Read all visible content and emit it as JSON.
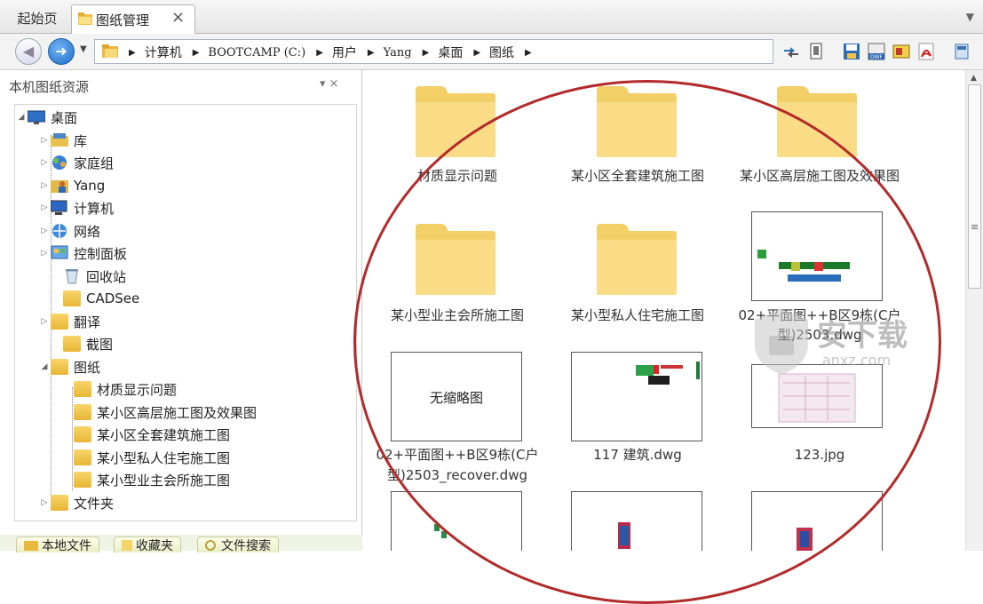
{
  "tabs": {
    "home": "起始页",
    "active": "图纸管理",
    "close": "×"
  },
  "address": {
    "crumbs": [
      "计算机",
      "BOOTCAMP (C:)",
      "用户",
      "Yang",
      "桌面",
      "图纸"
    ]
  },
  "panel": {
    "title": "本机图纸资源",
    "controls": "▾ ×"
  },
  "tree": {
    "root": "桌面",
    "items": [
      "库",
      "家庭组",
      "Yang",
      "计算机",
      "网络",
      "控制面板",
      "回收站",
      "CADSee",
      "翻译",
      "截图",
      "图纸",
      "文件夹"
    ],
    "children": [
      "材质显示问题",
      "某小区高层施工图及效果图",
      "某小区全套建筑施工图",
      "某小型私人住宅施工图",
      "某小型业主会所施工图"
    ]
  },
  "bottom_tabs": [
    "本地文件",
    "收藏夹",
    "文件搜索"
  ],
  "files": {
    "folder1": "材质显示问题",
    "folder2": "某小区全套建筑施工图",
    "folder3": "某小区高层施工图及效果图",
    "folder4": "某小型业主会所施工图",
    "folder5": "某小型私人住宅施工图",
    "dwg1_a": "02+平面图++B区9栋(C户",
    "dwg1_b": "型)2503.dwg",
    "nothumb_text": "无缩略图",
    "dwg2_a": "02+平面图++B区9栋(C户",
    "dwg2_b": "型)2503_recover.dwg",
    "dwg3": "117 建筑.dwg",
    "jpg1": "123.jpg"
  },
  "watermark": {
    "cn": "安下载",
    "en": "anxz.com"
  }
}
